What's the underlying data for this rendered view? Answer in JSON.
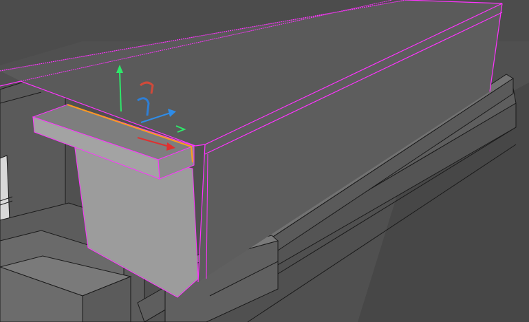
{
  "viewport": {
    "background": "#4c4c4c",
    "selection_color": "#ff33ff",
    "selected_edge_color": "#ff9a1f"
  },
  "gizmo": {
    "x_axis_color": "#e03030",
    "y_axis_color": "#2ee86a",
    "z_axis_color": "#2e8ce8",
    "x_rotate_icon": "x-rotate-arc-icon",
    "y_rotate_icon": "y-rotate-arc-icon",
    "z_rotate_icon": "z-rotate-arc-icon",
    "plane_handle_icon": "yz-plane-handle-icon"
  },
  "objects": [
    {
      "name": "selected-beam",
      "selected": true
    },
    {
      "name": "t-bracket",
      "selected": false
    },
    {
      "name": "rail-track",
      "selected": false
    },
    {
      "name": "left-block",
      "selected": false
    },
    {
      "name": "wall-panel",
      "selected": false
    }
  ]
}
